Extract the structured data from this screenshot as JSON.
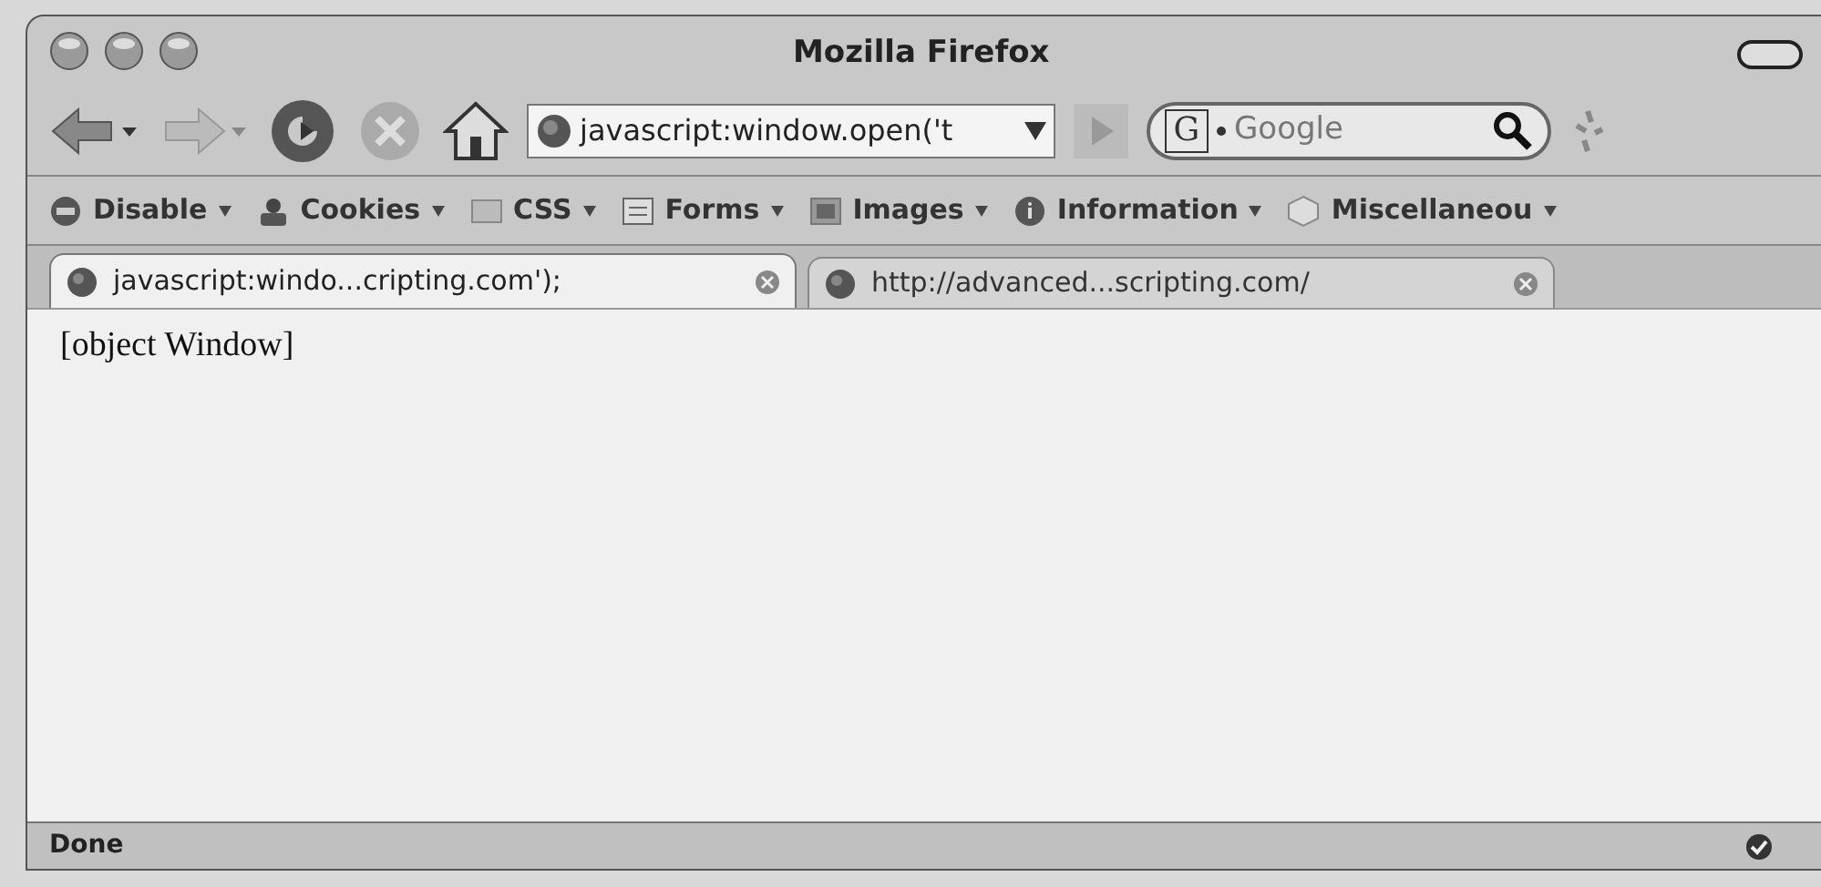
{
  "window": {
    "title": "Mozilla Firefox"
  },
  "address_bar": {
    "value": "javascript:window.open('t"
  },
  "search": {
    "engine_letter": "G",
    "placeholder": "Google"
  },
  "developer_toolbar": [
    {
      "label": "Disable",
      "kind": "disable"
    },
    {
      "label": "Cookies",
      "kind": "cookies"
    },
    {
      "label": "CSS",
      "kind": "css"
    },
    {
      "label": "Forms",
      "kind": "forms"
    },
    {
      "label": "Images",
      "kind": "images"
    },
    {
      "label": "Information",
      "kind": "information"
    },
    {
      "label": "Miscellaneou",
      "kind": "misc"
    }
  ],
  "tabs": [
    {
      "label": "javascript:windo...cripting.com');",
      "selected": true
    },
    {
      "label": "http://advanced...scripting.com/",
      "selected": false
    }
  ],
  "content": {
    "text": "[object Window]"
  },
  "status_bar": {
    "text": "Done"
  }
}
